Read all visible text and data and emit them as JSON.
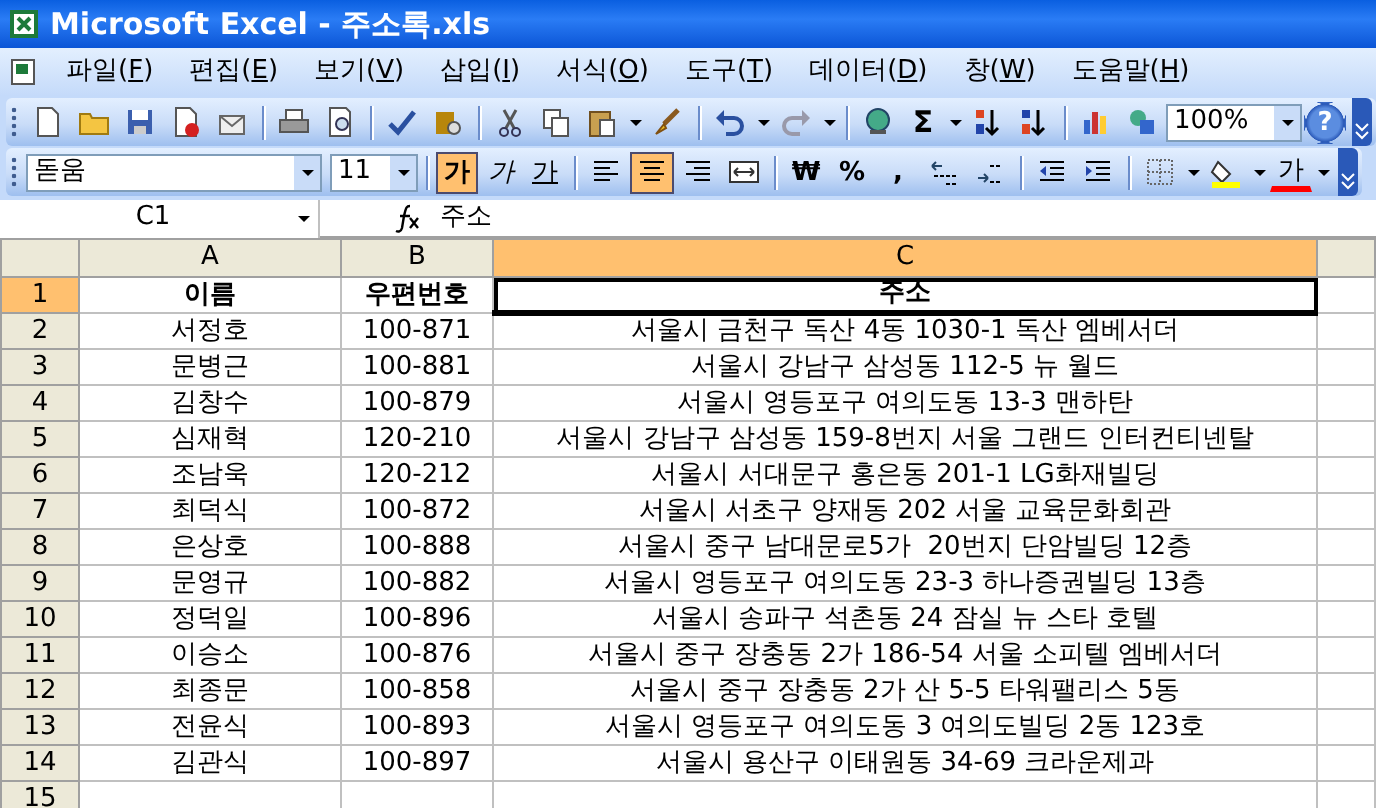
{
  "window": {
    "title": "Microsoft Excel - 주소록.xls"
  },
  "menu": [
    {
      "label": "파일(F)"
    },
    {
      "label": "편집(E)"
    },
    {
      "label": "보기(V)"
    },
    {
      "label": "삽입(I)"
    },
    {
      "label": "서식(O)"
    },
    {
      "label": "도구(T)"
    },
    {
      "label": "데이터(D)"
    },
    {
      "label": "창(W)"
    },
    {
      "label": "도움말(H)"
    }
  ],
  "standard_toolbar": {
    "autosum": "Σ",
    "zoom": "100%",
    "help": "?"
  },
  "formatting_toolbar": {
    "font": "돋움",
    "size": "11",
    "style_buttons": [
      {
        "label": "가",
        "kind": "bold",
        "selected": true
      },
      {
        "label": "가",
        "kind": "italic",
        "selected": false
      },
      {
        "label": "가",
        "kind": "underline",
        "selected": false
      }
    ],
    "align_buttons": [
      {
        "kind": "left",
        "selected": false
      },
      {
        "kind": "center",
        "selected": true
      },
      {
        "kind": "right",
        "selected": false
      },
      {
        "kind": "merge",
        "selected": false
      }
    ],
    "number_buttons": [
      "₩",
      "%",
      ","
    ],
    "font_color_label": "가"
  },
  "formula_bar": {
    "name_box": "C1",
    "formula": "주소"
  },
  "sheet": {
    "columns": [
      {
        "label": "A",
        "selected": false
      },
      {
        "label": "B",
        "selected": false
      },
      {
        "label": "C",
        "selected": true
      }
    ],
    "rows": [
      {
        "number": "1",
        "kind": "header",
        "selected": true,
        "cells": [
          "이름",
          "우편번호",
          "주소"
        ]
      },
      {
        "number": "2",
        "kind": "data",
        "selected": false,
        "cells": [
          "서정호",
          "100-871",
          "서울시 금천구 독산 4동 1030-1 독산 엠베서더"
        ]
      },
      {
        "number": "3",
        "kind": "data",
        "selected": false,
        "cells": [
          "문병근",
          "100-881",
          "서울시 강남구 삼성동 112-5 뉴 월드"
        ]
      },
      {
        "number": "4",
        "kind": "data",
        "selected": false,
        "cells": [
          "김창수",
          "100-879",
          "서울시 영등포구 여의도동 13-3 맨하탄"
        ]
      },
      {
        "number": "5",
        "kind": "data",
        "selected": false,
        "cells": [
          "심재혁",
          "120-210",
          "서울시 강남구 삼성동 159-8번지 서울 그랜드 인터컨티넨탈"
        ]
      },
      {
        "number": "6",
        "kind": "data",
        "selected": false,
        "cells": [
          "조남욱",
          "120-212",
          "서울시 서대문구 홍은동 201-1 LG화재빌딩"
        ]
      },
      {
        "number": "7",
        "kind": "data",
        "selected": false,
        "cells": [
          "최덕식",
          "100-872",
          "서울시 서초구 양재동 202 서울 교육문화회관"
        ]
      },
      {
        "number": "8",
        "kind": "data",
        "selected": false,
        "cells": [
          "은상호",
          "100-888",
          "서울시 중구 남대문로5가  20번지 단암빌딩 12층"
        ]
      },
      {
        "number": "9",
        "kind": "data",
        "selected": false,
        "cells": [
          "문영규",
          "100-882",
          "서울시 영등포구 여의도동 23-3 하나증권빌딩 13층"
        ]
      },
      {
        "number": "10",
        "kind": "data",
        "selected": false,
        "cells": [
          "정덕일",
          "100-896",
          "서울시 송파구 석촌동 24 잠실 뉴 스타 호텔"
        ]
      },
      {
        "number": "11",
        "kind": "data",
        "selected": false,
        "cells": [
          "이승소",
          "100-876",
          "서울시 중구 장충동 2가 186-54 서울 소피텔 엠베서더"
        ]
      },
      {
        "number": "12",
        "kind": "data",
        "selected": false,
        "cells": [
          "최종문",
          "100-858",
          "서울시 중구 장충동 2가 산 5-5 타워팰리스 5동"
        ]
      },
      {
        "number": "13",
        "kind": "data",
        "selected": false,
        "cells": [
          "전윤식",
          "100-893",
          "서울시 영등포구 여의도동 3 여의도빌딩 2동 123호"
        ]
      },
      {
        "number": "14",
        "kind": "data",
        "selected": false,
        "cells": [
          "김관식",
          "100-897",
          "서울시 용산구 이태원동 34-69 크라운제과"
        ]
      },
      {
        "number": "15",
        "kind": "data",
        "selected": false,
        "cells": []
      }
    ]
  }
}
